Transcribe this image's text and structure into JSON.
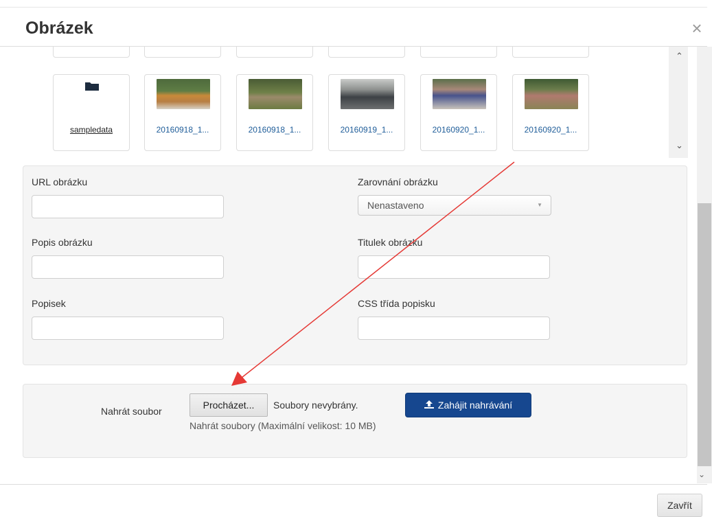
{
  "modal": {
    "title": "Obrázek",
    "close_symbol": "×",
    "close_button_label": "Zavřít"
  },
  "browser": {
    "top_row_count": 6,
    "items": [
      {
        "label": "sampledata",
        "kind": "folder",
        "icon": "folder-icon"
      },
      {
        "label": "20160918_1...",
        "kind": "image",
        "thumb_color": "#b78a52"
      },
      {
        "label": "20160918_1...",
        "kind": "image",
        "thumb_color": "#6f7d44"
      },
      {
        "label": "20160919_1...",
        "kind": "image",
        "thumb_color": "#6e7270"
      },
      {
        "label": "20160920_1...",
        "kind": "image",
        "thumb_color": "#8a6a5e"
      },
      {
        "label": "20160920_1...",
        "kind": "image",
        "thumb_color": "#7b6c57"
      }
    ]
  },
  "form": {
    "url_label": "URL obrázku",
    "url_value": "",
    "alignment_label": "Zarovnání obrázku",
    "alignment_value": "Nenastaveno",
    "description_label": "Popis obrázku",
    "description_value": "",
    "title_label": "Titulek obrázku",
    "title_value": "",
    "caption_label": "Popisek",
    "caption_value": "",
    "caption_class_label": "CSS třída popisku",
    "caption_class_value": ""
  },
  "upload": {
    "label": "Nahrát soubor",
    "browse_button": "Procházet...",
    "no_files": "Soubory nevybrány.",
    "start_button": "Zahájit nahrávání",
    "start_icon": "upload-icon",
    "help_text": "Nahrát soubory (Maximální velikost: 10 MB)"
  },
  "colors": {
    "primary_button": "#16478f",
    "link": "#1f5d99",
    "annotation_arrow": "#e53935"
  }
}
